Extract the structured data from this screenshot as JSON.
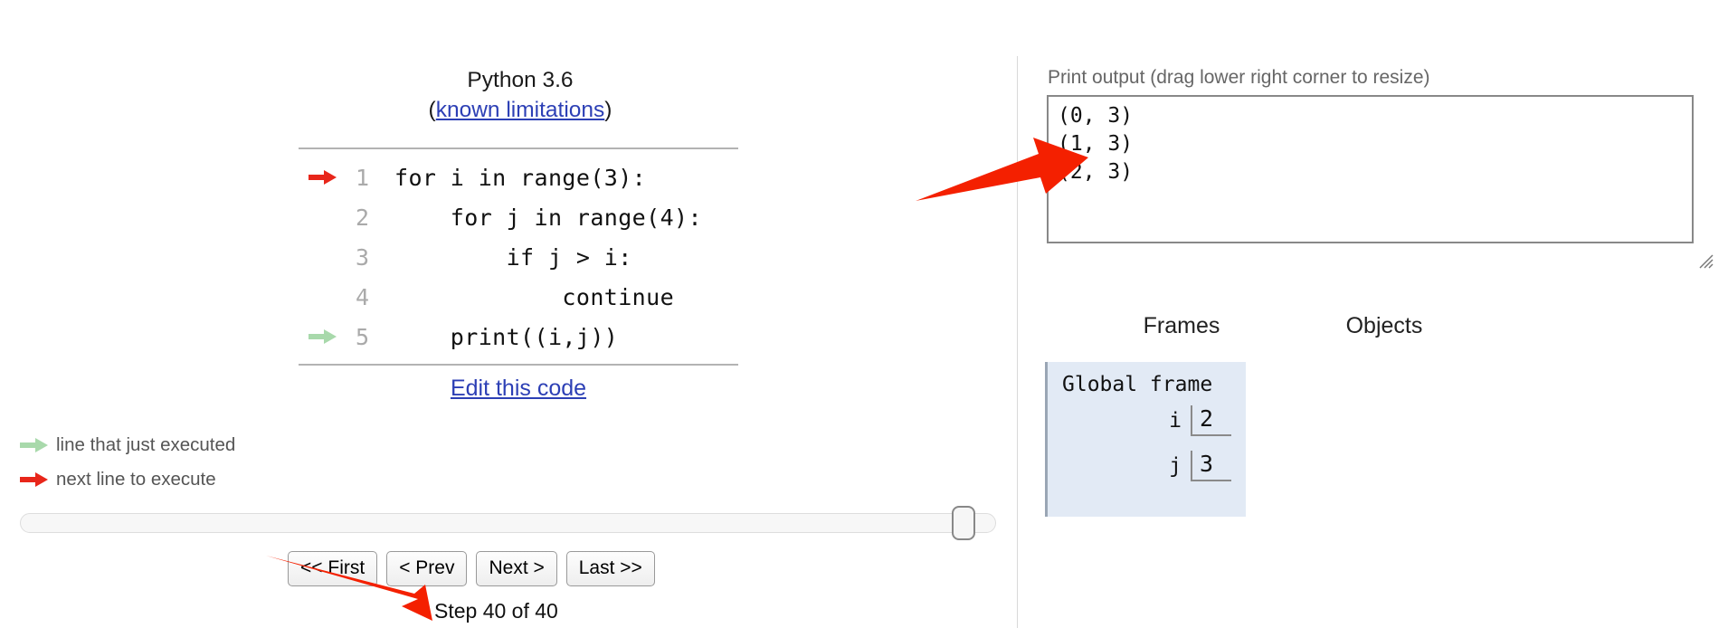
{
  "code_panel": {
    "language_title": "Python 3.6",
    "limitations_open_paren": "(",
    "limitations_link": "known limitations",
    "limitations_close_paren": ")",
    "edit_link": "Edit this code",
    "lines": [
      {
        "number": "1",
        "text": "for i in range(3):",
        "marker": "next"
      },
      {
        "number": "2",
        "text": "    for j in range(4):",
        "marker": "none"
      },
      {
        "number": "3",
        "text": "        if j > i:",
        "marker": "none"
      },
      {
        "number": "4",
        "text": "            continue",
        "marker": "none"
      },
      {
        "number": "5",
        "text": "    print((i,j))",
        "marker": "executed"
      }
    ]
  },
  "legend": {
    "items": [
      {
        "label": "line that just executed",
        "color": "#a8d9ab"
      },
      {
        "label": "next line to execute",
        "color": "#e8261a"
      }
    ]
  },
  "controls": {
    "buttons": [
      {
        "label": "<< First"
      },
      {
        "label": "< Prev"
      },
      {
        "label": "Next >"
      },
      {
        "label": "Last >>"
      }
    ],
    "step_counter": "Step 40 of 40",
    "slider_position_percent": 98
  },
  "output_panel": {
    "print_output_label": "Print output (drag lower right corner to resize)",
    "print_output_text": "(0, 3)\n(1, 3)\n(2, 3)",
    "resize_grip_icon": "resize-grip-icon"
  },
  "visualization": {
    "frames_heading": "Frames",
    "objects_heading": "Objects",
    "global_frame": {
      "title": "Global frame",
      "variables": [
        {
          "name": "i",
          "value": "2"
        },
        {
          "name": "j",
          "value": "3"
        }
      ]
    }
  },
  "annotations": {
    "arrow_to_output": "red-annotation-arrow",
    "arrow_to_step_counter": "red-annotation-arrow"
  },
  "colors": {
    "link": "#2c3fb5",
    "next_line_arrow": "#e8261a",
    "executed_line_arrow": "#a8d9ab",
    "frame_background": "#e2eaf5",
    "annotation_red": "#f42000"
  }
}
